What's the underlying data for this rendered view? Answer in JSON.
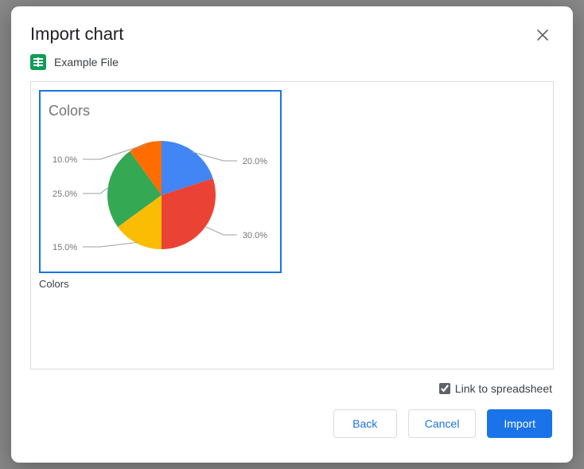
{
  "dialog": {
    "title": "Import chart",
    "file_name": "Example File",
    "chart_caption": "Colors",
    "link_label": "Link to spreadsheet",
    "link_checked": true,
    "buttons": {
      "back": "Back",
      "cancel": "Cancel",
      "import": "Import"
    }
  },
  "chart_data": {
    "type": "pie",
    "title": "Colors",
    "series": [
      {
        "name": "Blue",
        "value": 20.0,
        "label": "20.0%",
        "color": "#4285F4"
      },
      {
        "name": "Red",
        "value": 30.0,
        "label": "30.0%",
        "color": "#EA4335"
      },
      {
        "name": "Yellow",
        "value": 15.0,
        "label": "15.0%",
        "color": "#FBBC04"
      },
      {
        "name": "Green",
        "value": 25.0,
        "label": "25.0%",
        "color": "#34A853"
      },
      {
        "name": "Orange",
        "value": 10.0,
        "label": "10.0%",
        "color": "#FF6D01"
      }
    ]
  }
}
